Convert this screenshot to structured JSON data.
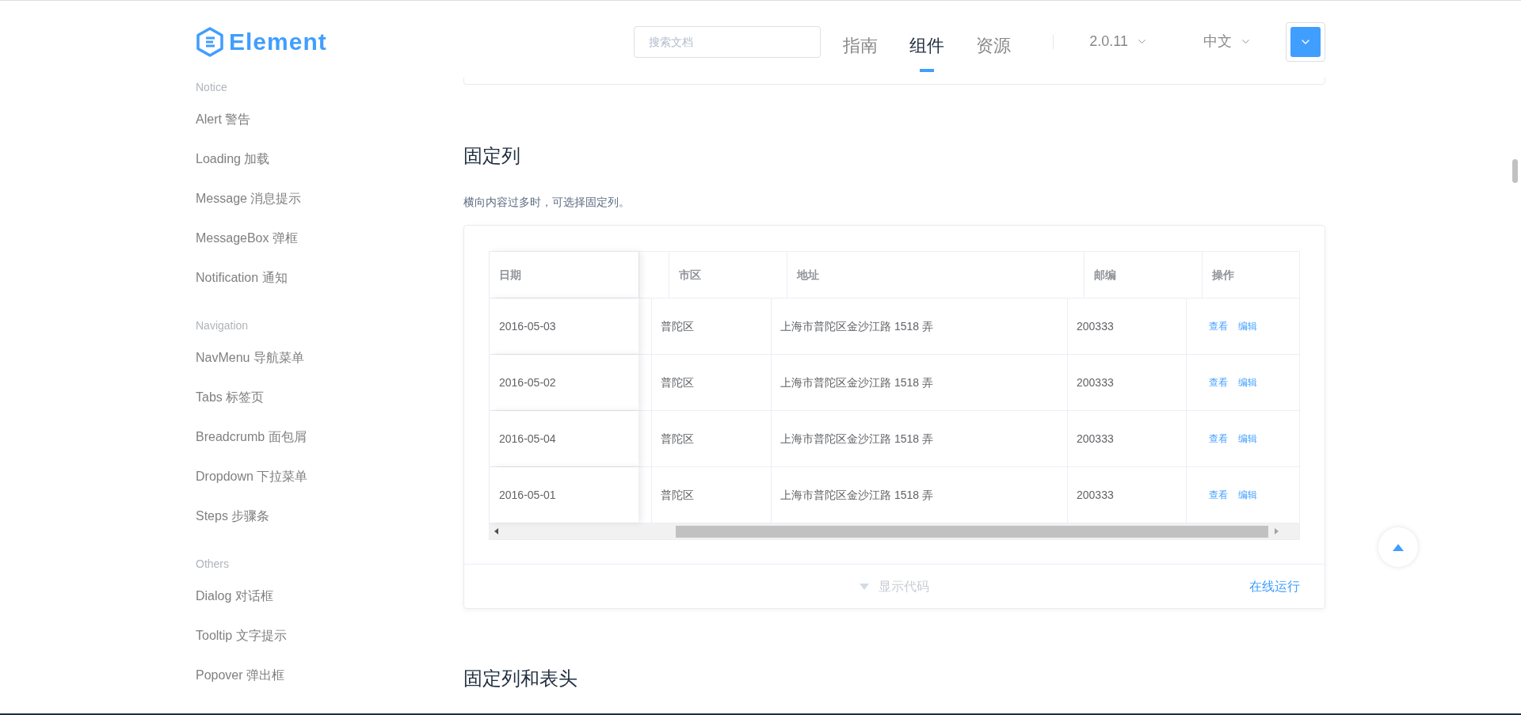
{
  "header": {
    "logo": "Element",
    "search": {
      "placeholder": "搜索文档"
    },
    "nav": [
      {
        "label": "指南",
        "selected": false
      },
      {
        "label": "组件",
        "selected": true
      },
      {
        "label": "资源",
        "selected": false
      }
    ],
    "version": "2.0.11",
    "language": "中文"
  },
  "sidebar": {
    "groups": [
      {
        "title": "Notice",
        "items": [
          "Alert 警告",
          "Loading 加载",
          "Message 消息提示",
          "MessageBox 弹框",
          "Notification 通知"
        ]
      },
      {
        "title": "Navigation",
        "items": [
          "NavMenu 导航菜单",
          "Tabs 标签页",
          "Breadcrumb 面包屑",
          "Dropdown 下拉菜单",
          "Steps 步骤条"
        ]
      },
      {
        "title": "Others",
        "items": [
          "Dialog 对话框",
          "Tooltip 文字提示",
          "Popover 弹出框"
        ]
      }
    ]
  },
  "section": {
    "title": "固定列",
    "description": "横向内容过多时，可选择固定列。",
    "table": {
      "columns": [
        "日期",
        "市区",
        "地址",
        "邮编",
        "操作"
      ],
      "rows": [
        {
          "date": "2016-05-03",
          "district": "普陀区",
          "address": "上海市普陀区金沙江路 1518 弄",
          "zip": "200333",
          "actions": [
            "查看",
            "编辑"
          ]
        },
        {
          "date": "2016-05-02",
          "district": "普陀区",
          "address": "上海市普陀区金沙江路 1518 弄",
          "zip": "200333",
          "actions": [
            "查看",
            "编辑"
          ]
        },
        {
          "date": "2016-05-04",
          "district": "普陀区",
          "address": "上海市普陀区金沙江路 1518 弄",
          "zip": "200333",
          "actions": [
            "查看",
            "编辑"
          ]
        },
        {
          "date": "2016-05-01",
          "district": "普陀区",
          "address": "上海市普陀区金沙江路 1518 弄",
          "zip": "200333",
          "actions": [
            "查看",
            "编辑"
          ]
        }
      ]
    },
    "show_code": "显示代码",
    "run_online": "在线运行"
  },
  "next_section": {
    "title": "固定列和表头"
  }
}
